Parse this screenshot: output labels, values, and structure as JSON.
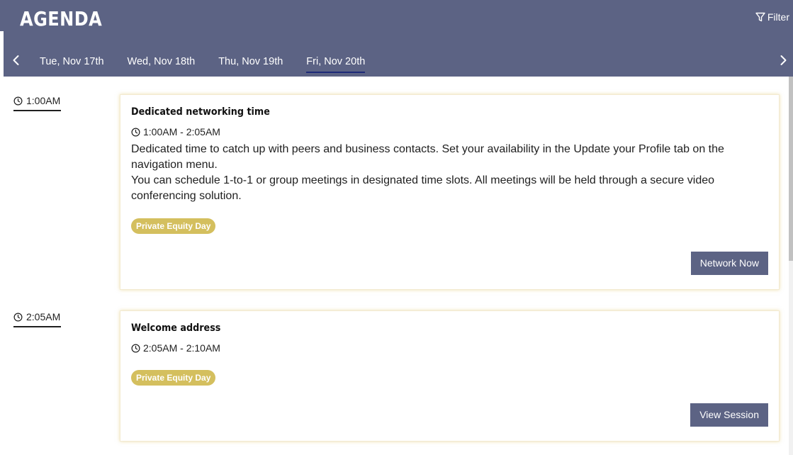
{
  "header": {
    "title": "AGENDA",
    "filter_label": "Filter",
    "filter_icon": "funnel-icon"
  },
  "nav": {
    "prev_icon": "chevron-left-icon",
    "next_icon": "chevron-right-icon",
    "tabs": [
      {
        "label": "Tue, Nov 17th"
      },
      {
        "label": "Wed, Nov 18th"
      },
      {
        "label": "Thu, Nov 19th"
      },
      {
        "label": "Fri, Nov 20th",
        "active": true
      }
    ]
  },
  "sessions": [
    {
      "start_time": "1:00AM",
      "title": "Dedicated networking time",
      "time_range": "1:00AM - 2:05AM",
      "description": [
        "Dedicated time to catch up with peers and business contacts. Set your availability in the Update your Profile tab on the navigation menu.",
        "You can schedule 1-to-1 or group meetings in designated time slots. All meetings will be held through a secure video conferencing solution."
      ],
      "tag": "Private Equity Day",
      "button_label": "Network Now"
    },
    {
      "start_time": "2:05AM",
      "title": "Welcome address",
      "time_range": "2:05AM - 2:10AM",
      "tag": "Private Equity Day",
      "button_label": "View Session"
    }
  ],
  "colors": {
    "header_bg": "#5c6384",
    "active_tab_underline": "#1e2a78",
    "tag_bg": "#d4bf5e",
    "button_bg": "#5c6384"
  }
}
